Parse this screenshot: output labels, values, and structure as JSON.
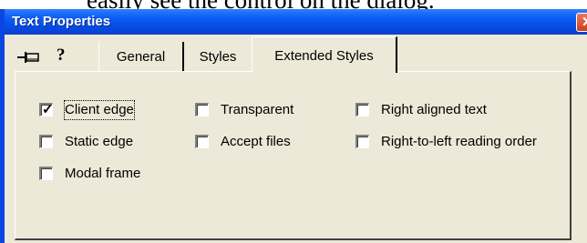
{
  "background_text": "easily see the control on the dialog.",
  "dialog": {
    "title": "Text Properties",
    "close_glyph": "✕",
    "help_glyph": "?",
    "tabs": [
      {
        "label": "General",
        "active": false
      },
      {
        "label": "Styles",
        "active": false
      },
      {
        "label": "Extended Styles",
        "active": true
      }
    ],
    "options": [
      {
        "label": "Client edge",
        "checked": true,
        "check_glyph": "✓",
        "focused": true
      },
      {
        "label": "Static edge",
        "checked": false
      },
      {
        "label": "Modal frame",
        "checked": false
      },
      {
        "label": "Transparent",
        "checked": false
      },
      {
        "label": "Accept files",
        "checked": false
      },
      {
        "label": "Right aligned text",
        "checked": false
      },
      {
        "label": "Right-to-left reading order",
        "checked": false
      }
    ]
  },
  "colors": {
    "titlebar": "#0a5cf5",
    "dialog_face": "#ece9d8",
    "close_button": "#c8401c"
  }
}
